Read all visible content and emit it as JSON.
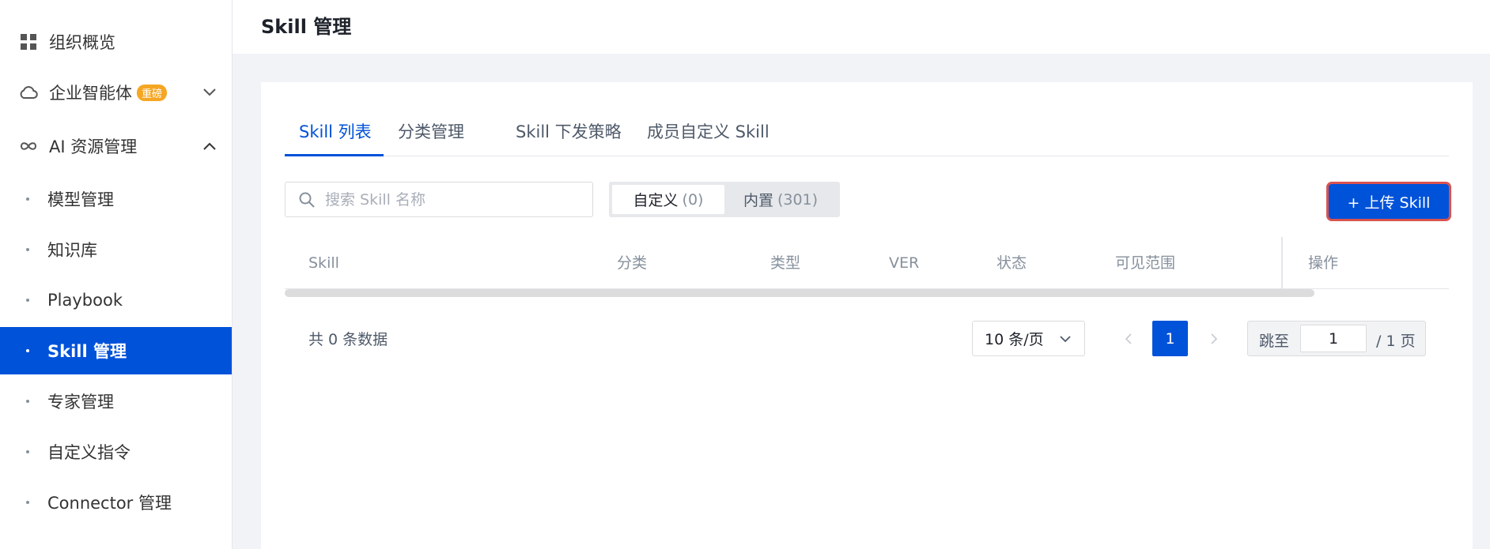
{
  "sidebar": {
    "top_items": [
      {
        "label": "组织概览",
        "icon": "grid-icon"
      },
      {
        "label": "企业智能体",
        "icon": "cloud-icon",
        "badge": "重磅"
      },
      {
        "label": "AI 资源管理",
        "icon": "infinity-icon"
      }
    ],
    "sub_items": [
      {
        "label": "模型管理"
      },
      {
        "label": "知识库"
      },
      {
        "label": "Playbook"
      },
      {
        "label": "Skill 管理",
        "active": true
      },
      {
        "label": "专家管理"
      },
      {
        "label": "自定义指令"
      },
      {
        "label": "Connector 管理"
      }
    ]
  },
  "header": {
    "title": "Skill 管理"
  },
  "tabs": [
    "Skill 列表",
    "分类管理",
    "Skill 下发策略",
    "成员自定义 Skill"
  ],
  "search": {
    "placeholder": "搜索 Skill 名称"
  },
  "segment": {
    "custom_label": "自定义",
    "custom_count": "(0)",
    "builtin_label": "内置",
    "builtin_count": "(301)"
  },
  "upload_button": "+ 上传 Skill",
  "table": {
    "columns": [
      "Skill",
      "分类",
      "类型",
      "VER",
      "状态",
      "可见范围",
      "操作"
    ]
  },
  "pagination": {
    "total": "共 0 条数据",
    "page_size": "10 条/页",
    "current_page": "1",
    "jump_label": "跳至",
    "jump_value": "1",
    "total_pages": "/ 1 页"
  },
  "colors": {
    "primary": "#0052d9",
    "badge": "#f5a623",
    "highlight_border": "#d9534f"
  }
}
